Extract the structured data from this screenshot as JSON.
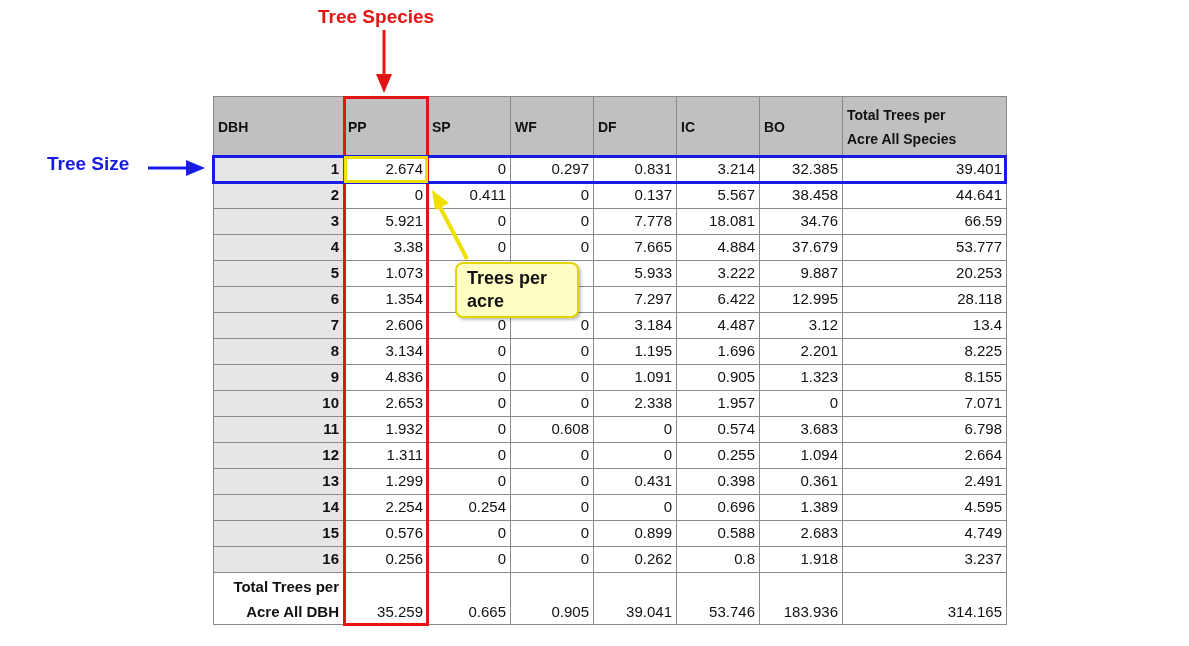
{
  "annotations": {
    "column_label": "Tree Species",
    "row_label": "Tree Size",
    "callout": "Trees per acre"
  },
  "table": {
    "columns": [
      "DBH",
      "PP",
      "SP",
      "WF",
      "DF",
      "IC",
      "BO",
      "Total Trees per Acre All Species"
    ],
    "rows": [
      {
        "dbh": "1",
        "values": [
          "2.674",
          "0",
          "0.297",
          "0.831",
          "3.214",
          "32.385",
          "39.401"
        ]
      },
      {
        "dbh": "2",
        "values": [
          "0",
          "0.411",
          "0",
          "0.137",
          "5.567",
          "38.458",
          "44.641"
        ]
      },
      {
        "dbh": "3",
        "values": [
          "5.921",
          "0",
          "0",
          "7.778",
          "18.081",
          "34.76",
          "66.59"
        ]
      },
      {
        "dbh": "4",
        "values": [
          "3.38",
          "0",
          "0",
          "7.665",
          "4.884",
          "37.679",
          "53.777"
        ]
      },
      {
        "dbh": "5",
        "values": [
          "1.073",
          "5.933",
          "3.222",
          "9.887",
          "20.253"
        ],
        "under_callout": true
      },
      {
        "dbh": "6",
        "values": [
          "1.354",
          "7.297",
          "6.422",
          "12.995",
          "28.118"
        ],
        "under_callout": true
      },
      {
        "dbh": "7",
        "values": [
          "2.606",
          "0",
          "0",
          "3.184",
          "4.487",
          "3.12",
          "13.4"
        ]
      },
      {
        "dbh": "8",
        "values": [
          "3.134",
          "0",
          "0",
          "1.195",
          "1.696",
          "2.201",
          "8.225"
        ]
      },
      {
        "dbh": "9",
        "values": [
          "4.836",
          "0",
          "0",
          "1.091",
          "0.905",
          "1.323",
          "8.155"
        ]
      },
      {
        "dbh": "10",
        "values": [
          "2.653",
          "0",
          "0",
          "2.338",
          "1.957",
          "0",
          "7.071"
        ]
      },
      {
        "dbh": "11",
        "values": [
          "1.932",
          "0",
          "0.608",
          "0",
          "0.574",
          "3.683",
          "6.798"
        ]
      },
      {
        "dbh": "12",
        "values": [
          "1.311",
          "0",
          "0",
          "0",
          "0.255",
          "1.094",
          "2.664"
        ]
      },
      {
        "dbh": "13",
        "values": [
          "1.299",
          "0",
          "0",
          "0.431",
          "0.398",
          "0.361",
          "2.491"
        ]
      },
      {
        "dbh": "14",
        "values": [
          "2.254",
          "0.254",
          "0",
          "0",
          "0.696",
          "1.389",
          "4.595"
        ]
      },
      {
        "dbh": "15",
        "values": [
          "0.576",
          "0",
          "0",
          "0.899",
          "0.588",
          "2.683",
          "4.749"
        ]
      },
      {
        "dbh": "16",
        "values": [
          "0.256",
          "0",
          "0",
          "0.262",
          "0.8",
          "1.918",
          "3.237"
        ]
      }
    ],
    "total_row": {
      "label": "Total Trees per Acre All DBH",
      "values": [
        "35.259",
        "0.665",
        "0.905",
        "39.041",
        "53.746",
        "183.936",
        "314.165"
      ]
    }
  }
}
